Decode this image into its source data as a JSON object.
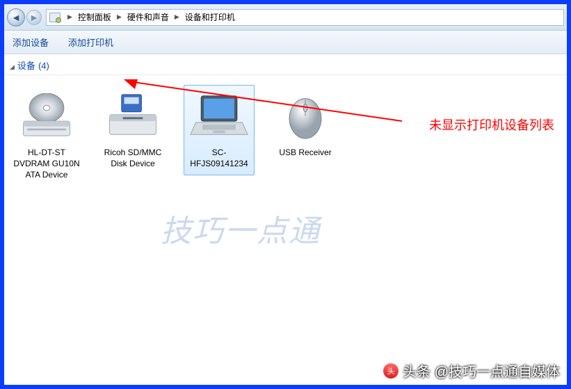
{
  "breadcrumb": {
    "items": [
      "控制面板",
      "硬件和声音",
      "设备和打印机"
    ]
  },
  "toolbar": {
    "add_device": "添加设备",
    "add_printer": "添加打印机"
  },
  "section": {
    "label": "设备",
    "count": "(4)"
  },
  "devices": [
    {
      "name": "HL-DT-ST DVDRAM GU10N ATA Device",
      "icon": "optical-drive",
      "selected": false
    },
    {
      "name": "Ricoh SD/MMC Disk Device",
      "icon": "card-reader",
      "selected": false
    },
    {
      "name": "SC-HFJS09141234",
      "icon": "laptop",
      "selected": true
    },
    {
      "name": "USB Receiver",
      "icon": "mouse",
      "selected": false
    }
  ],
  "annotation": {
    "text": "未显示打印机设备列表",
    "color": "#ff0000"
  },
  "watermark": {
    "center": "技巧一点通",
    "footer": "头条 @技巧一点通自媒体",
    "logo_text": "头条"
  }
}
